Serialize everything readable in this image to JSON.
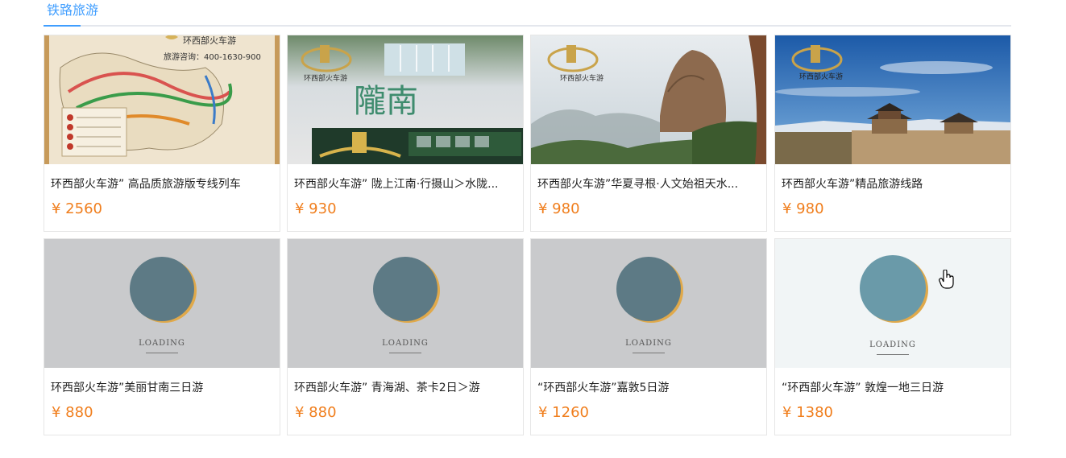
{
  "tabs": [
    {
      "label": "铁路旅游"
    }
  ],
  "products": [
    {
      "title": "环西部火车游” 高品质旅游版专线列车",
      "price": "¥ 2560",
      "image": "map"
    },
    {
      "title": "环西部火车游” 陇上江南·行摄山＞水陇...",
      "price": "¥ 930",
      "image": "longnan"
    },
    {
      "title": "环西部火车游”华夏寻根·人文始祖天水...",
      "price": "¥ 980",
      "image": "mountain"
    },
    {
      "title": "环西部火车游”精品旅游线路",
      "price": "¥ 980",
      "image": "fortress"
    },
    {
      "title": "环西部火车游”美丽甘南三日游",
      "price": "¥ 880",
      "image": "loading"
    },
    {
      "title": "环西部火车游” 青海湖、茶卡2日＞游",
      "price": "¥ 880",
      "image": "loading"
    },
    {
      "title": "“环西部火车游”嘉敦5日游",
      "price": "¥ 1260",
      "image": "loading"
    },
    {
      "title": "“环西部火车游” 敦煌一地三日游",
      "price": "¥ 1380",
      "image": "loading-light"
    }
  ],
  "image_text": {
    "brand": "环西部火车游",
    "hotline": "旅游咨询：400-1630-900",
    "longnan": "隴南",
    "loading": "LOADING"
  },
  "colors": {
    "accent": "#409eff",
    "price": "#f07e1d"
  }
}
